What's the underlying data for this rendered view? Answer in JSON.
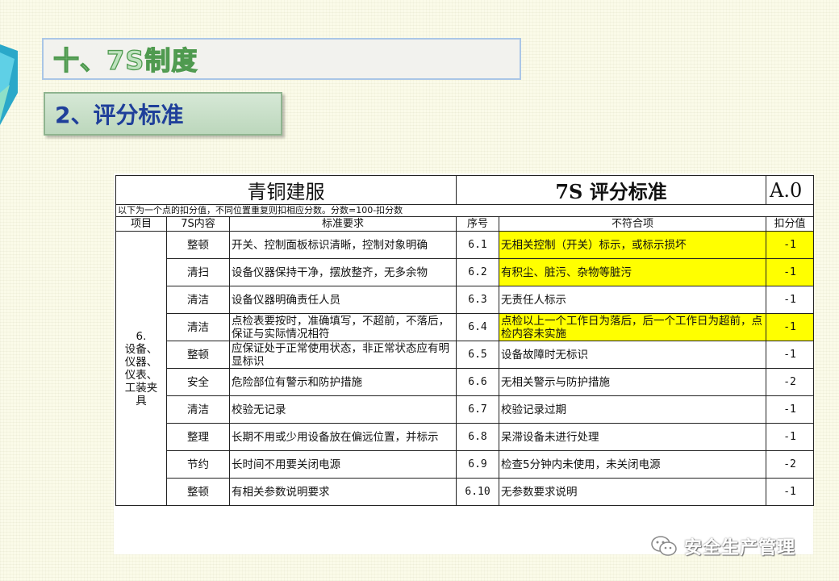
{
  "slide": {
    "title": "十、7S制度",
    "subtitle": "2、评分标准"
  },
  "sheet": {
    "doc_title": "青铜建服",
    "standard_title": "7S 评分标准",
    "version": "A.0",
    "note": "以下为一个点的扣分值，不同位置重复则扣相应分数。分数=100-扣分数",
    "columns": [
      "项目",
      "7S内容",
      "标准要求",
      "序号",
      "不符合项",
      "扣分值"
    ],
    "category": "6.\n设备、\n仪器、\n仪表、\n工装夹\n具",
    "rows": [
      {
        "content": "整顿",
        "requirement": "开关、控制面板标识清晰，控制对象明确",
        "no": "6.1",
        "issue": "无相关控制（开关）标示，或标示损坏",
        "score": "-1",
        "highlight": true
      },
      {
        "content": "清扫",
        "requirement": "设备仪器保持干净，摆放整齐，无多余物",
        "no": "6.2",
        "issue": "有积尘、脏污、杂物等脏污",
        "score": "-1",
        "highlight": true
      },
      {
        "content": "清洁",
        "requirement": "设备仪器明确责任人员",
        "no": "6.3",
        "issue": "无责任人标示",
        "score": "-1",
        "highlight": false
      },
      {
        "content": "清洁",
        "requirement": "点检表要按时，准确填写，不超前，不落后，保证与实际情况相符",
        "no": "6.4",
        "issue": "点检以上一个工作日为落后，后一个工作日为超前，点检内容未实施",
        "score": "-1",
        "highlight": true
      },
      {
        "content": "整顿",
        "requirement": "应保证处于正常使用状态，非正常状态应有明显标识",
        "no": "6.5",
        "issue": "设备故障时无标识",
        "score": "-1",
        "highlight": false
      },
      {
        "content": "安全",
        "requirement": "危险部位有警示和防护措施",
        "no": "6.6",
        "issue": "无相关警示与防护措施",
        "score": "-2",
        "highlight": false
      },
      {
        "content": "清洁",
        "requirement": "校验无记录",
        "no": "6.7",
        "issue": "校验记录过期",
        "score": "-1",
        "highlight": false
      },
      {
        "content": "整理",
        "requirement": "长期不用或少用设备放在偏远位置，并标示",
        "no": "6.8",
        "issue": "呆滞设备未进行处理",
        "score": "-1",
        "highlight": false
      },
      {
        "content": "节约",
        "requirement": "长时间不用要关闭电源",
        "no": "6.9",
        "issue": "检查5分钟内未使用，未关闭电源",
        "score": "-2",
        "highlight": false
      },
      {
        "content": "整顿",
        "requirement": "有相关参数说明要求",
        "no": "6.10",
        "issue": "无参数要求说明",
        "score": "-1",
        "highlight": false
      }
    ]
  },
  "watermark": {
    "text": "安全生产管理",
    "icon": "wechat-icon"
  },
  "colors": {
    "highlight": "#ffff00",
    "subtitle_text": "#1f3f9a",
    "title_outline": "#4f9a4f"
  }
}
